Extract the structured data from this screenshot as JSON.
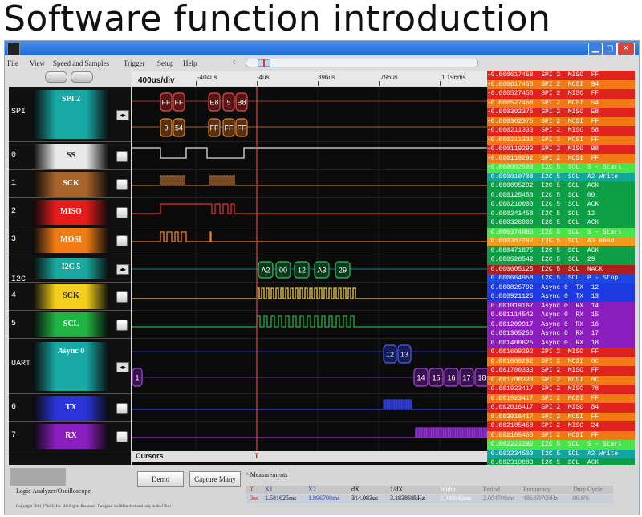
{
  "page_title": "Software function introduction",
  "window": {
    "controls": {
      "minimize": "▁",
      "maximize": "▢",
      "close": "✕"
    }
  },
  "menu": [
    "File",
    "View",
    "Speed and Samples",
    "Trigger",
    "Setup",
    "Help"
  ],
  "timebase": {
    "div_label": "400us/div",
    "ticks": [
      "-404us",
      "-4us",
      "396us",
      "796us",
      "1.196ms"
    ]
  },
  "channels": [
    {
      "num": "SPI",
      "name": "SPI 2",
      "color": "#18a9a4",
      "ctrl": "bus"
    },
    {
      "num": "0",
      "name": "SS",
      "color": "#e8e8e8",
      "ctrl": "check"
    },
    {
      "num": "1",
      "name": "SCK",
      "color": "#a8642a",
      "ctrl": "check"
    },
    {
      "num": "2",
      "name": "MISO",
      "color": "#e31b1b",
      "ctrl": "check"
    },
    {
      "num": "3",
      "name": "MOSI",
      "color": "#f07c16",
      "ctrl": "check"
    },
    {
      "num": "I2C",
      "name": "I2C 5",
      "color": "#1aa99f",
      "ctrl": "bus"
    },
    {
      "num": "4",
      "name": "SCK",
      "color": "#f4d01c",
      "ctrl": "check"
    },
    {
      "num": "5",
      "name": "SCL",
      "color": "#21b341",
      "ctrl": "check"
    },
    {
      "num": "UART",
      "name": "Async 0",
      "color": "#18a9a4",
      "ctrl": "bus"
    },
    {
      "num": "6",
      "name": "TX",
      "color": "#2a34d8",
      "ctrl": "check"
    },
    {
      "num": "7",
      "name": "RX",
      "color": "#8a1ec0",
      "ctrl": "check"
    }
  ],
  "decoded": {
    "spi_miso": [
      "FF",
      "FF",
      "E8",
      "5",
      "B8"
    ],
    "spi_mosi": [
      "9",
      "54",
      "FF",
      "FF",
      "FF"
    ],
    "i2c": [
      "A2",
      "00",
      "12",
      "A3",
      "29"
    ],
    "uart_tx": [
      "12",
      "13"
    ],
    "uart_rx_first": "1",
    "uart_rx": [
      "14",
      "15",
      "16",
      "17",
      "18"
    ]
  },
  "trigger_marker": "T",
  "cursors_label": "Cursors",
  "list_rows": [
    {
      "text": "-0.000617458  SPI 2  MISO  FF",
      "color": "#e0231f"
    },
    {
      "text": "-0.000617458  SPI 2  MOSI  94",
      "color": "#f27a14"
    },
    {
      "text": "-0.000527458  SPI 2  MISO  FF",
      "color": "#e0231f"
    },
    {
      "text": "-0.000527458  SPI 2  MOSI  54",
      "color": "#f27a14"
    },
    {
      "text": "-0.000302375  SPI 2  MISO  E8",
      "color": "#e0231f"
    },
    {
      "text": "-0.000302375  SPI 2  MOSI  FF",
      "color": "#f27a14"
    },
    {
      "text": "-0.000211333  SPI 2  MISO  58",
      "color": "#e0231f"
    },
    {
      "text": "-0.000211333  SPI 2  MOSI  FF",
      "color": "#f27a14"
    },
    {
      "text": "-0.000119292  SPI 2  MISO  B8",
      "color": "#e0231f"
    },
    {
      "text": "-0.000119292  SPI 2  MOSI  FF",
      "color": "#f27a14"
    },
    {
      "text": "-0.000002500  I2C 5  SCL  S - Start",
      "color": "#49e34a"
    },
    {
      "text": " 0.000010708  I2C 5  SCL  A2 Write",
      "color": "#13a6a1"
    },
    {
      "text": " 0.000095292  I2C 5  SCL  ACK",
      "color": "#0e9e45"
    },
    {
      "text": " 0.000125458  I2C 5  SCL  00",
      "color": "#0e9e45"
    },
    {
      "text": " 0.000210000  I2C 5  SCL  ACK",
      "color": "#0e9e45"
    },
    {
      "text": " 0.000241458  I2C 5  SCL  12",
      "color": "#0e9e45"
    },
    {
      "text": " 0.000326000  I2C 5  SCL  ACK",
      "color": "#0e9e45"
    },
    {
      "text": " 0.000374083  I2C 5  SCL  S - Start",
      "color": "#49e34a"
    },
    {
      "text": " 0.000387292  I2C 5  SCL  A3 Read",
      "color": "#f29a1c"
    },
    {
      "text": " 0.000471875  I2C 5  SCL  ACK",
      "color": "#0e9e45"
    },
    {
      "text": " 0.000520542  I2C 5  SCL  29",
      "color": "#0e9e45"
    },
    {
      "text": " 0.000605125  I2C 5  SCL  NACK",
      "color": "#b01d1d"
    },
    {
      "text": " 0.000664958  I2C 5  SCL  P - Stop",
      "color": "#1d49e3"
    },
    {
      "text": " 0.000825792  Async 0  TX  12",
      "color": "#1d3ae3"
    },
    {
      "text": " 0.000921125  Async 0  TX  13",
      "color": "#1d3ae3"
    },
    {
      "text": " 0.001019167  Async 0  RX  14",
      "color": "#8c1ebd"
    },
    {
      "text": " 0.001114542  Async 0  RX  15",
      "color": "#8c1ebd"
    },
    {
      "text": " 0.001209917  Async 0  RX  16",
      "color": "#8c1ebd"
    },
    {
      "text": " 0.001305250  Async 0  RX  17",
      "color": "#8c1ebd"
    },
    {
      "text": " 0.001400625  Async 0  RX  18",
      "color": "#8c1ebd"
    },
    {
      "text": " 0.001609292  SPI 2  MISO  FF",
      "color": "#e0231f"
    },
    {
      "text": " 0.001609292  SPI 2  MOSI  0C",
      "color": "#f27a14"
    },
    {
      "text": " 0.001700333  SPI 2  MISO  FF",
      "color": "#e0231f"
    },
    {
      "text": " 0.001700333  SPI 2  MOSI  8C",
      "color": "#f27a14"
    },
    {
      "text": " 0.001923417  SPI 2  MISO  78",
      "color": "#e0231f"
    },
    {
      "text": " 0.001923417  SPI 2  MOSI  FF",
      "color": "#f27a14"
    },
    {
      "text": " 0.002016417  SPI 2  MISO  84",
      "color": "#e0231f"
    },
    {
      "text": " 0.002016417  SPI 2  MOSI  FF",
      "color": "#f27a14"
    },
    {
      "text": " 0.002105458  SPI 2  MISO  24",
      "color": "#e0231f"
    },
    {
      "text": " 0.002105458  SPI 2  MOSI  FF",
      "color": "#f27a14"
    },
    {
      "text": " 0.002221292  I2C 5  SCL  S - Start",
      "color": "#49e34a"
    },
    {
      "text": " 0.002234500  I2C 5  SCL  A2 Write",
      "color": "#13a6a1"
    },
    {
      "text": " 0.002319083  I2C 5  SCL  ACK",
      "color": "#0e9e45"
    }
  ],
  "bottom": {
    "demo": "Demo",
    "capture": "Capture Many",
    "app_label": "Logic Analyzer/Oscilloscope",
    "copyright": "Copyright 2011, CWAV, Inc. All Rights Reserved. Designed and Manufactured only in the USA!",
    "measurements_title": "Measurements",
    "headers": [
      "T",
      "X1",
      "X2",
      "dX",
      "1/dX",
      "Width",
      "Period",
      "Frequency",
      "Duty Cycle"
    ],
    "values": [
      "0ns",
      "1.581625ms",
      "1.896708ms",
      "314.083us",
      "3.183868kHz",
      "2.048042ms",
      "2.054708ms",
      "486.68709Hz",
      "99.6%"
    ]
  }
}
